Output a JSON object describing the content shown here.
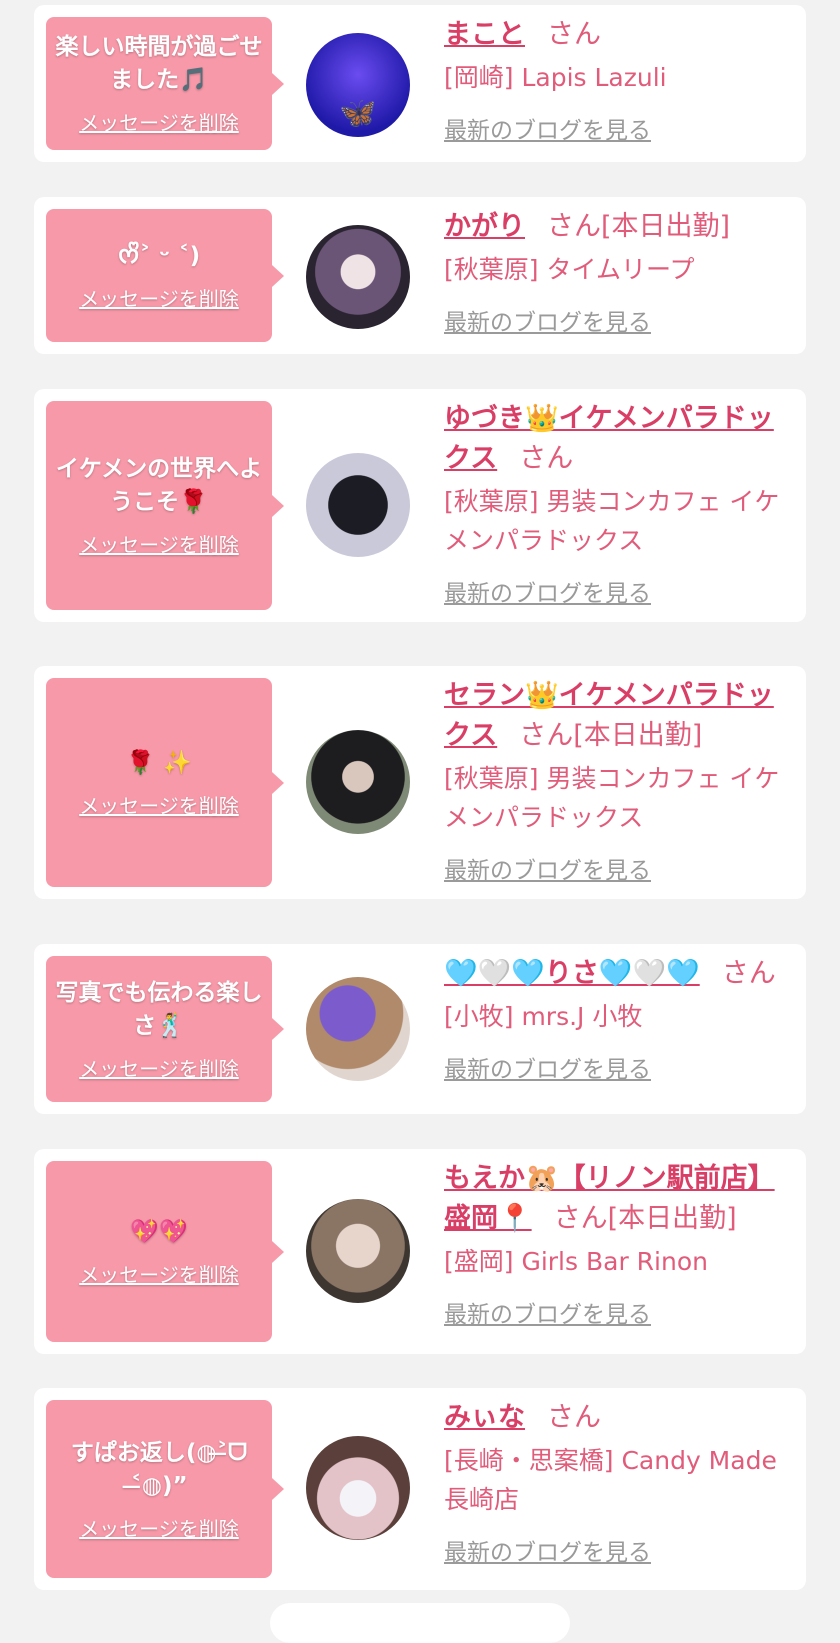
{
  "delete_label": "メッセージを削除",
  "blog_label": "最新のブログを見る",
  "san_label": "さん",
  "items": [
    {
      "message": "楽しい時間が過ごせました🎵",
      "name": "まこと",
      "badge": "",
      "shop": "[岡崎] Lapis Lazuli",
      "avatar_color": "#3a3ad8"
    },
    {
      "message": "ᰔᩚ˃ ᵕ ˂)",
      "name": "かがり",
      "badge": "[本日出勤]",
      "shop": "[秋葉原] タイムリープ",
      "avatar_color": "#5a4a5e"
    },
    {
      "message": "イケメンの世界へようこそ🌹",
      "name": "ゆづき👑イケメンパラドックス",
      "badge": "",
      "shop": "[秋葉原] 男装コンカフェ イケメンパラドックス",
      "avatar_color": "#3e3a48"
    },
    {
      "message": "🌹 ✨",
      "name": "セラン👑イケメンパラドックス",
      "badge": "[本日出勤]",
      "shop": "[秋葉原] 男装コンカフェ イケメンパラドックス",
      "avatar_color": "#2e2e30"
    },
    {
      "message": "写真でも伝わる楽しさ🕺",
      "name": "🩵🤍🩵りさ🩵🤍🩵",
      "badge": "",
      "shop": "[小牧] mrs.J 小牧",
      "avatar_color": "#8a6a8e"
    },
    {
      "message": "💖💖",
      "name": "もえか🐹【リノン駅前店】盛岡📍",
      "badge": "[本日出勤]",
      "shop": "[盛岡] Girls Bar Rinon",
      "avatar_color": "#6e6258"
    },
    {
      "message": "すぱお返し(◍˃̶ᗜ˂̶◍)”",
      "name": "みぃな",
      "badge": "",
      "shop": "[長崎・思案橋] Candy Made 長崎店",
      "avatar_color": "#d7b9c2"
    }
  ]
}
